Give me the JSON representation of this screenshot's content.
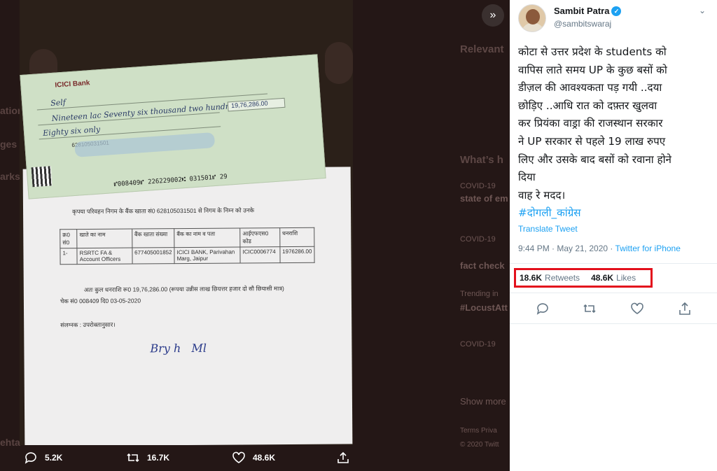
{
  "lightbox": {
    "photo": {
      "cheque": {
        "bank_name": "ICICI Bank",
        "pay_to": "Self",
        "rupees_words_1": "Nineteen lac Seventy six thousand two hundred",
        "rupees_words_2": "Eighty six only",
        "amount": "19,76,286.00",
        "account_no": "628105031501",
        "micr": "⑈008409⑈ 226229002⑆ 031501⑈ 29"
      },
      "letter": {
        "para": "कृपया परिवहन निगम के बैंक खाता सं0 628105031501 से निगम के निम्न को उनके",
        "table_headers": [
          "क्र0 सं0",
          "खाते का नाम",
          "बैंक खाता संख्या",
          "बैंक का नाम व पता",
          "आईएफएस0 कोड",
          "धनराशि"
        ],
        "table_row": [
          "1-",
          "RSRTC FA & Account Officers",
          "677405001852",
          "ICICI BANK, Parivahan Marg, Jaipur",
          "ICIC0006774",
          "1976286.00"
        ],
        "total_line": "अतः कुल धनराशि रू0 19,76,286.00 (रूपया उन्नीस लाख छियत्तर हजार दो सौ छियासी मात्र)",
        "cheque_line": "चेक सं0 008409 दि0 03-05-2020",
        "enclosure": "संलग्नक : उपरोक्तानुसार।"
      }
    },
    "expand_icon": "double-chevron-right-icon",
    "action_bar": {
      "reply_count": "5.2K",
      "retweet_count": "16.7K",
      "like_count": "48.6K"
    }
  },
  "tweet": {
    "author_name": "Sambit Patra",
    "handle": "@sambitswaraj",
    "text_lines": [
      "कोटा से उत्तर प्रदेश के students को",
      "वापिस लाते समय UP के कुछ बसों को",
      "डीज़ल की आवश्यकता पड़ गयी ..दया",
      "छोड़िए ..आधि रात को दफ़्तर खुलवा",
      "कर प्रियंका वाड्रा की राजस्थान सरकार",
      "ने UP सरकार से पहले 19 लाख रुपए",
      "लिए और उसके बाद बसों को रवाना होने",
      "दिया",
      "वाह रे मदद।"
    ],
    "hashtag": "#दोगली_कांग्रेस",
    "translate_label": "Translate Tweet",
    "time": "9:44 PM · May 21, 2020 ·",
    "source": "Twitter for iPhone",
    "retweets_count": "18.6K",
    "retweets_label": "Retweets",
    "likes_count": "48.6K",
    "likes_label": "Likes",
    "highlight_color": "#e3101c",
    "accent_color": "#1da1f2"
  },
  "background": {
    "relevant_label": "Relevant",
    "whats_label": "What’s h",
    "covid_1": "COVID-19",
    "covid_1b": "state of em",
    "covid_2": "COVID-19",
    "covid_2b": "fact check",
    "trending": "Trending in",
    "locust": "#LocustAtt",
    "covid_3": "COVID-19",
    "show_more": "Show more",
    "terms": "Terms Priva",
    "copyright": "© 2020 Twitt",
    "left_1": "ation",
    "left_2": "ges",
    "left_3": "arks",
    "left_4": "ehta"
  }
}
